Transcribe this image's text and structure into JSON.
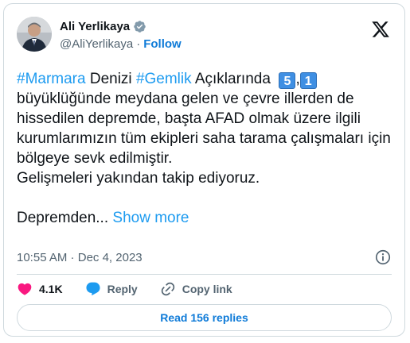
{
  "author": {
    "name": "Ali Yerlikaya",
    "handle": "@AliYerlikaya",
    "separator": "·",
    "follow_label": "Follow"
  },
  "tweet": {
    "line1_tag1": "#Marmara",
    "line1_text1": " Denizi ",
    "line1_tag2": "#Gemlik",
    "line1_text2": " Açıklarında  ",
    "magnitude_digit1": "5",
    "magnitude_comma": ",",
    "magnitude_digit2": "1",
    "rest_para1": "büyüklüğünde meydana gelen ve çevre illerden de hissedilen depremde, başta AFAD olmak üzere ilgili kurumlarımızın tüm ekipleri saha tarama çalışmaları için bölgeye sevk edilmiştir.",
    "para2": "Gelişmeleri yakından takip ediyoruz.",
    "para3": "Depremden...",
    "show_more": "Show more"
  },
  "meta": {
    "time": "10:55 AM",
    "separator": " · ",
    "date": "Dec 4, 2023"
  },
  "actions": {
    "likes": "4.1K",
    "reply_label": "Reply",
    "copy_link_label": "Copy link"
  },
  "read_replies_label": "Read 156 replies",
  "colors": {
    "link": "#1d9bf0",
    "like": "#f91880",
    "reply": "#1d9bf0",
    "text_secondary": "#536471"
  }
}
